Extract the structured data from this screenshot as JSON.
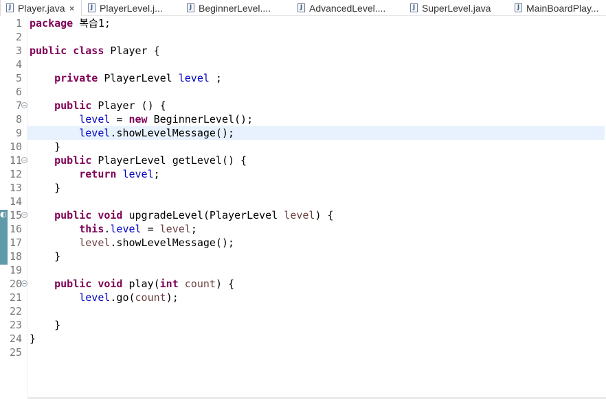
{
  "tabs": [
    {
      "label": "Player.java",
      "active": true,
      "close": "×"
    },
    {
      "label": "PlayerLevel.j...",
      "active": false
    },
    {
      "label": "BeginnerLevel....",
      "active": false
    },
    {
      "label": "AdvancedLevel....",
      "active": false
    },
    {
      "label": "SuperLevel.java",
      "active": false
    },
    {
      "label": "MainBoardPlay...",
      "active": false
    }
  ],
  "editor": {
    "current_line": 9,
    "lines": [
      {
        "n": "1",
        "t": [
          [
            "kw",
            "package"
          ],
          [
            "p",
            " 복습1;"
          ]
        ]
      },
      {
        "n": "2",
        "t": []
      },
      {
        "n": "3",
        "t": [
          [
            "kw",
            "public"
          ],
          [
            "p",
            " "
          ],
          [
            "kw",
            "class"
          ],
          [
            "p",
            " Player {"
          ]
        ]
      },
      {
        "n": "4",
        "t": []
      },
      {
        "n": "5",
        "t": [
          [
            "p",
            "    "
          ],
          [
            "kw",
            "private"
          ],
          [
            "p",
            " PlayerLevel "
          ],
          [
            "fld",
            "level"
          ],
          [
            "p",
            " ;"
          ]
        ]
      },
      {
        "n": "6",
        "t": []
      },
      {
        "n": "7",
        "fold": true,
        "t": [
          [
            "p",
            "    "
          ],
          [
            "kw",
            "public"
          ],
          [
            "p",
            " Player () {"
          ]
        ]
      },
      {
        "n": "8",
        "t": [
          [
            "p",
            "        "
          ],
          [
            "fld",
            "level"
          ],
          [
            "p",
            " = "
          ],
          [
            "kw",
            "new"
          ],
          [
            "p",
            " BeginnerLevel();"
          ]
        ]
      },
      {
        "n": "9",
        "t": [
          [
            "p",
            "        "
          ],
          [
            "fld",
            "level"
          ],
          [
            "p",
            ".showLevelMessage();"
          ]
        ]
      },
      {
        "n": "10",
        "t": [
          [
            "p",
            "    }"
          ]
        ]
      },
      {
        "n": "11",
        "fold": true,
        "t": [
          [
            "p",
            "    "
          ],
          [
            "kw",
            "public"
          ],
          [
            "p",
            " PlayerLevel getLevel() {"
          ]
        ]
      },
      {
        "n": "12",
        "t": [
          [
            "p",
            "        "
          ],
          [
            "kw",
            "return"
          ],
          [
            "p",
            " "
          ],
          [
            "fld",
            "level"
          ],
          [
            "p",
            ";"
          ]
        ]
      },
      {
        "n": "13",
        "t": [
          [
            "p",
            "    }"
          ]
        ]
      },
      {
        "n": "14",
        "t": []
      },
      {
        "n": "15",
        "fold": true,
        "t": [
          [
            "p",
            "    "
          ],
          [
            "kw",
            "public"
          ],
          [
            "p",
            " "
          ],
          [
            "kw",
            "void"
          ],
          [
            "p",
            " upgradeLevel(PlayerLevel "
          ],
          [
            "par",
            "level"
          ],
          [
            "p",
            ") {"
          ]
        ]
      },
      {
        "n": "16",
        "t": [
          [
            "p",
            "        "
          ],
          [
            "kw",
            "this"
          ],
          [
            "p",
            "."
          ],
          [
            "fld",
            "level"
          ],
          [
            "p",
            " = "
          ],
          [
            "par",
            "level"
          ],
          [
            "p",
            ";"
          ]
        ]
      },
      {
        "n": "17",
        "t": [
          [
            "p",
            "        "
          ],
          [
            "par",
            "level"
          ],
          [
            "p",
            ".showLevelMessage();"
          ]
        ]
      },
      {
        "n": "18",
        "t": [
          [
            "p",
            "    }"
          ]
        ]
      },
      {
        "n": "19",
        "t": []
      },
      {
        "n": "20",
        "fold": true,
        "t": [
          [
            "p",
            "    "
          ],
          [
            "kw",
            "public"
          ],
          [
            "p",
            " "
          ],
          [
            "kw",
            "void"
          ],
          [
            "p",
            " play("
          ],
          [
            "kw",
            "int"
          ],
          [
            "p",
            " "
          ],
          [
            "par",
            "count"
          ],
          [
            "p",
            ") {"
          ]
        ]
      },
      {
        "n": "21",
        "t": [
          [
            "p",
            "        "
          ],
          [
            "fld",
            "level"
          ],
          [
            "p",
            ".go("
          ],
          [
            "par",
            "count"
          ],
          [
            "p",
            ");"
          ]
        ]
      },
      {
        "n": "22",
        "t": []
      },
      {
        "n": "23",
        "t": [
          [
            "p",
            "    }"
          ]
        ]
      },
      {
        "n": "24",
        "t": [
          [
            "p",
            "}"
          ]
        ]
      },
      {
        "n": "25",
        "t": []
      }
    ]
  },
  "icons": {
    "tab_file": "java-file-icon",
    "fold": "collapse-icon"
  },
  "colors": {
    "keyword": "#7f0055",
    "field": "#0000c0",
    "parameter": "#6a3e3e",
    "current_line": "#e8f2fe"
  }
}
